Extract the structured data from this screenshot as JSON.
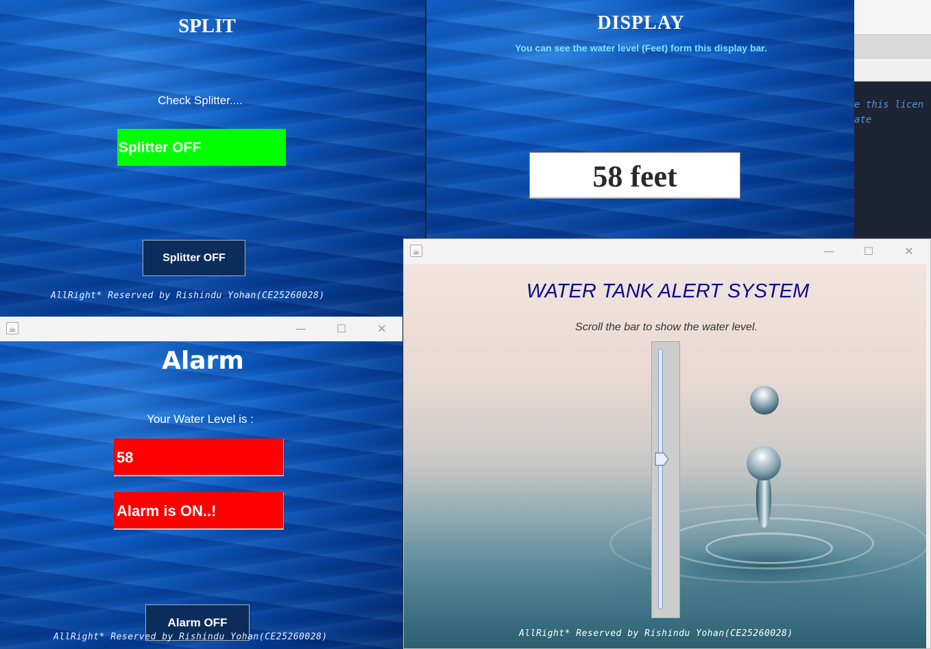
{
  "split_window": {
    "title": "SPLIT",
    "label": "Check Splitter....",
    "status": "Splitter OFF",
    "button": "Splitter OFF",
    "footer": "AllRight* Reserved by Rishindu Yohan(CE25260028)"
  },
  "display_window": {
    "title": "DISPLAY",
    "subtitle": "You can see the water level (Feet) form this display bar.",
    "value": "58 feet"
  },
  "ide_background": {
    "line1": "e this licen",
    "line2": "ate"
  },
  "alarm_window": {
    "title": "Alarm",
    "label": "Your Water Level is :",
    "level": "58",
    "status": "Alarm is ON..!",
    "button": "Alarm OFF",
    "footer": "AllRight* Reserved by Rishindu Yohan(CE25260028)"
  },
  "main_window": {
    "title": "WATER TANK ALERT SYSTEM",
    "subtitle": "Scroll the bar to show the water level.",
    "footer": "AllRight* Reserved by Rishindu Yohan(CE25260028)",
    "slider_value_fraction": 0.58
  },
  "titlebar": {
    "minimize": "—",
    "maximize": "☐",
    "close": "✕",
    "app_icon": "☕"
  },
  "colors": {
    "splitter_status": "#00ff00",
    "alarm_red": "#ff0000",
    "dark_button": "#0c2d5c",
    "main_title": "#0a0a8c",
    "display_subtitle": "#7fe1ff"
  }
}
